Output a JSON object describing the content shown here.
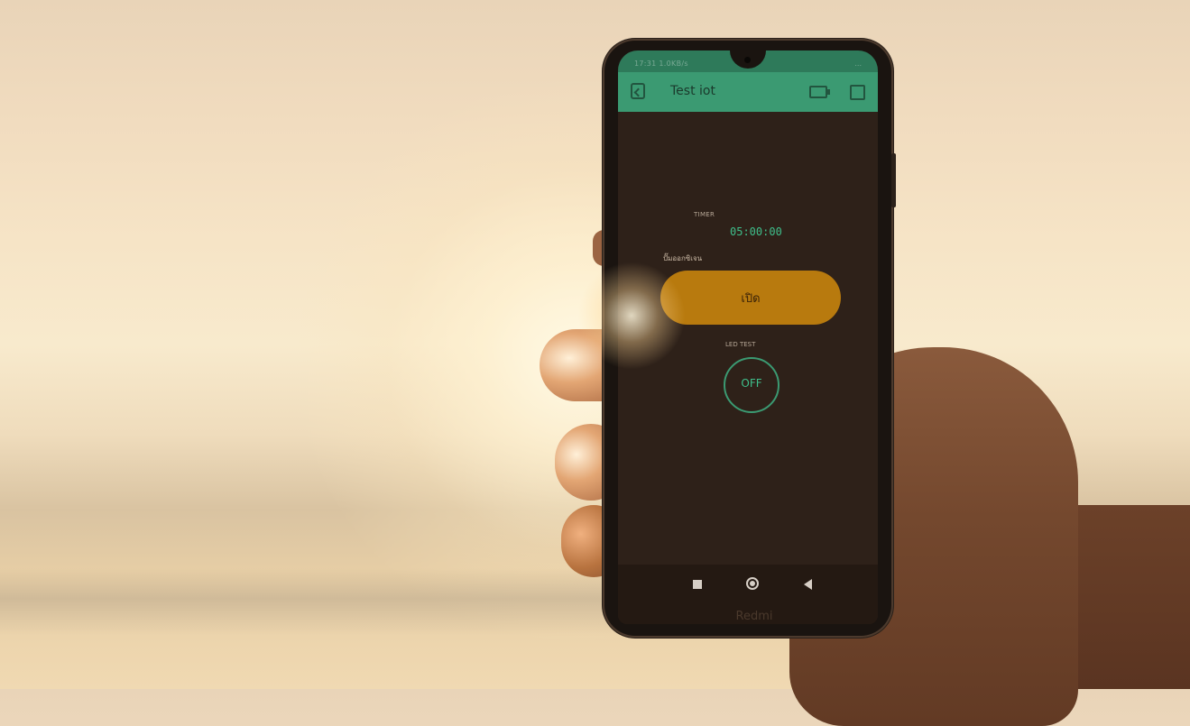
{
  "status_bar": {
    "time": "17:31",
    "speed": "1.0KB/s",
    "right": "..."
  },
  "app_bar": {
    "title": "Test iot"
  },
  "widgets": {
    "timer": {
      "label": "TIMER",
      "value": "05:00:00"
    },
    "pump": {
      "label": "ปั๊มออกซิเจน",
      "button_label": "เปิด"
    },
    "led": {
      "label": "LED TEST",
      "button_label": "OFF"
    }
  },
  "device_brand": "Redmi",
  "icons": {
    "back": "back-icon",
    "device": "device-icon",
    "stop": "stop-icon",
    "nav_recent": "nav-recent-icon",
    "nav_home": "nav-home-icon",
    "nav_back": "nav-back-icon"
  },
  "colors": {
    "app_bar": "#3b9a72",
    "accent_green": "#3fbf8b",
    "pump_button": "#b87a0e",
    "screen_bg": "#2e2119"
  }
}
